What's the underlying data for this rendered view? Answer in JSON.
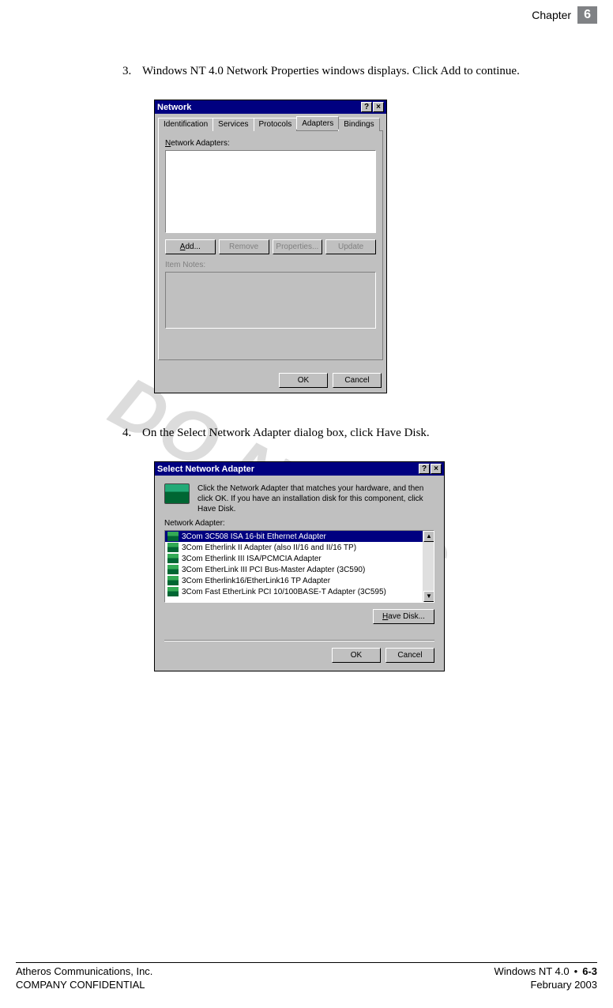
{
  "header": {
    "label": "Chapter",
    "number": "6"
  },
  "steps": {
    "s3": {
      "num": "3.",
      "text": "Windows NT 4.0 Network Properties windows displays. Click Add to continue."
    },
    "s4": {
      "num": "4.",
      "text": "On the Select Network Adapter dialog box, click Have Disk."
    }
  },
  "dialog1": {
    "title": "Network",
    "help": "?",
    "close": "×",
    "tabs": {
      "identification": "Identification",
      "services": "Services",
      "protocols": "Protocols",
      "adapters": "Adapters",
      "bindings": "Bindings"
    },
    "label_adapters": "Network Adapters:",
    "btn_add": "Add...",
    "btn_remove": "Remove",
    "btn_properties": "Properties...",
    "btn_update": "Update",
    "label_notes": "Item Notes:",
    "btn_ok": "OK",
    "btn_cancel": "Cancel"
  },
  "dialog2": {
    "title": "Select Network Adapter",
    "help": "?",
    "close": "×",
    "desc": "Click the Network Adapter that matches your hardware, and then click OK. If you have an installation disk for this component, click Have Disk.",
    "label_adapter": "Network Adapter:",
    "items": [
      "3Com 3C508 ISA 16-bit Ethernet Adapter",
      "3Com Etherlink II Adapter (also II/16 and II/16 TP)",
      "3Com Etherlink III ISA/PCMCIA Adapter",
      "3Com EtherLink III PCI Bus-Master Adapter (3C590)",
      "3Com Etherlink16/EtherLink16 TP Adapter",
      "3Com Fast EtherLink PCI 10/100BASE-T Adapter (3C595)"
    ],
    "btn_havedisk": "Have Disk...",
    "btn_ok": "OK",
    "btn_cancel": "Cancel"
  },
  "watermark": "DO NOT C",
  "footer": {
    "company": "Atheros Communications, Inc.",
    "confidential": "COMPANY CONFIDENTIAL",
    "product": "Windows NT 4.0",
    "page": "6-3",
    "date": "February 2003"
  }
}
